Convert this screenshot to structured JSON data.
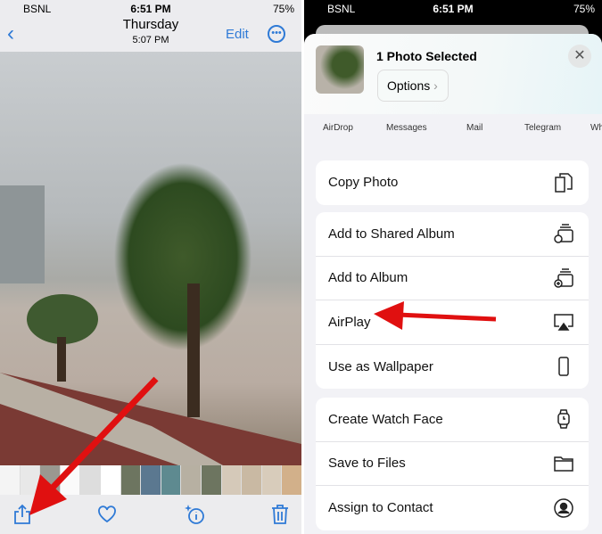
{
  "left": {
    "status": {
      "carrier": "BSNL",
      "time": "6:51 PM",
      "battery": "75%"
    },
    "nav": {
      "title": "Thursday",
      "subtitle": "5:07 PM",
      "edit": "Edit"
    },
    "toolbar": [
      "share-icon",
      "heart-icon",
      "info-sparkle-icon",
      "trash-icon"
    ]
  },
  "right": {
    "status": {
      "carrier": "BSNL",
      "time": "6:51 PM",
      "battery": "75%"
    },
    "header": {
      "title": "1 Photo Selected",
      "options": "Options"
    },
    "apps": [
      "AirDrop",
      "Messages",
      "Mail",
      "Telegram",
      "Wh"
    ],
    "groups": [
      [
        {
          "label": "Copy Photo",
          "icon": "copy-icon"
        }
      ],
      [
        {
          "label": "Add to Shared Album",
          "icon": "shared-album-icon"
        },
        {
          "label": "Add to Album",
          "icon": "add-album-icon"
        },
        {
          "label": "AirPlay",
          "icon": "airplay-icon"
        },
        {
          "label": "Use as Wallpaper",
          "icon": "phone-icon"
        }
      ],
      [
        {
          "label": "Create Watch Face",
          "icon": "watch-icon"
        },
        {
          "label": "Save to Files",
          "icon": "folder-icon"
        },
        {
          "label": "Assign to Contact",
          "icon": "contact-icon"
        }
      ]
    ]
  },
  "colors": {
    "accent": "#2f7ad6",
    "arrow": "#e01010"
  }
}
